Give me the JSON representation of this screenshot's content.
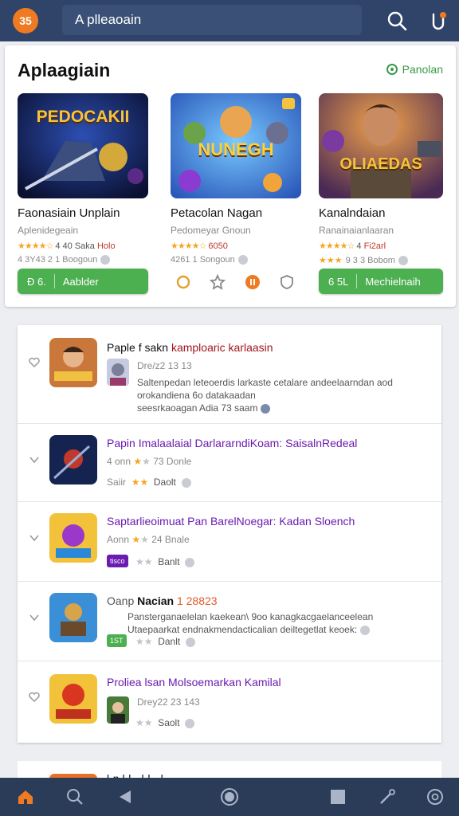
{
  "topbar": {
    "logo_text": "35",
    "search_text": "A  plleaoain"
  },
  "featured": {
    "title": "Aplaagiain",
    "link_label": "Panolan",
    "games": [
      {
        "art_title": "PEDOCAKII",
        "name": "Faonasiain Unplain",
        "sub": "Aplenidegeain",
        "rating_text": "4 40 Saka",
        "rating_red": "Holo",
        "meta": "4 3Y43 2 1 Boogoun"
      },
      {
        "art_title": "NUNEGH",
        "name": "Petacolan Nagan",
        "sub": "Pedomeyar Gnoun",
        "rating_text": "",
        "rating_red": "6050",
        "meta": "4261  1 Songoun"
      },
      {
        "art_title": "OLIAEDAS",
        "name": "Kanalndaian",
        "sub": "Ranainaianlaaran",
        "rating_text": "4",
        "rating_red": "Fi2arl",
        "meta": "9 3 3 Bobom"
      }
    ],
    "buttons": [
      {
        "left": "Ð  6.",
        "label": "Aablder"
      },
      {
        "left": "6  5L",
        "label": "Mechielnaih"
      }
    ]
  },
  "list": {
    "rows": [
      {
        "title_a": "Paple f sakn ",
        "title_b": "kamploaric karlaasin",
        "meta": "Dre/z2 13 13",
        "desc1": "Saltenpedan leteoerdis larkaste cetalare andeelaarndan aod",
        "desc2": "orokandiena 6o datakaadan",
        "desc3": "seesrkaoagan Adia 73 saam"
      },
      {
        "title": "Papin  Imalaalaial DarlararndiKoam: SaisalnRedeal",
        "rating": "4 onn",
        "rating2": "73 Donle",
        "sub": "Saiir",
        "sub2": "Daolt"
      },
      {
        "title": "Saptarlieoimuat Pan BarelNoegar: Kadan Sloench",
        "rating": "Aonn",
        "rating2": "24 Bnale",
        "badge": "tisco",
        "sub2": "Banlt"
      },
      {
        "title_a": "Oanp   ",
        "title_b": "Nacian",
        "title_c": " 1 28823",
        "desc1": "Pansterganaelelan kaekean\\ 9oo kanagkacgaelanceelean",
        "desc2": "Utaepaarkat endnakmendacticalian deiltegetlat keoek:",
        "badge": "1ST",
        "sub2": "Danlt"
      },
      {
        "title": "Proliea lsan Molsoemarkan Kamilal",
        "meta": "Drey22 23 143",
        "sub2": "Saolt"
      }
    ],
    "peek_text": "l-n l-l--  l-l-- l-"
  }
}
